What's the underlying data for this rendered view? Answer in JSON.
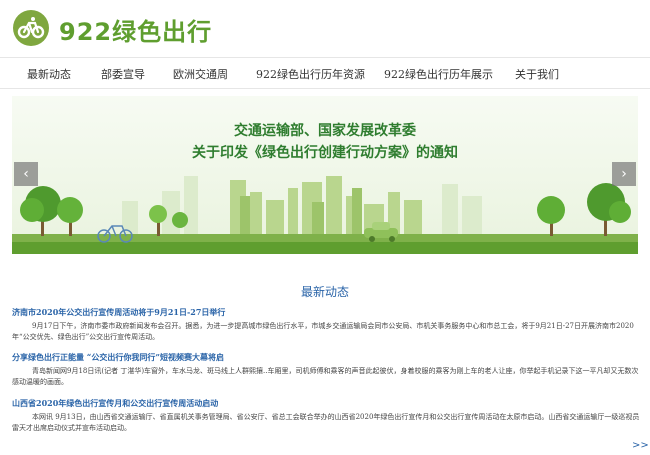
{
  "site": {
    "name": "922绿色出行",
    "brand_color": "#5f9e2f"
  },
  "nav": {
    "items": [
      {
        "label": "最新动态"
      },
      {
        "label": "部委宣导"
      },
      {
        "label": "欧洲交通周"
      },
      {
        "label": "922绿色出行历年资源"
      },
      {
        "label": "922绿色出行历年展示"
      },
      {
        "label": "关于我们"
      }
    ]
  },
  "banner": {
    "line1": "交通运输部、国家发展改革委",
    "line2": "关于印发《绿色出行创建行动方案》的通知",
    "prev_icon": "chevron-left-icon",
    "next_icon": "chevron-right-icon"
  },
  "news": {
    "section_title": "最新动态",
    "articles": [
      {
        "title": "济南市2020年公交出行宣传周活动将于9月21日-27日举行",
        "body": "9月17日下午，济南市委市政府新闻发布会召开。据悉，为进一步提高城市绿色出行水平，市城乡交通运输局会同市公安局、市机关事务服务中心和市总工会，将于9月21日-27日开展济南市2020年“公交优先、绿色出行”公交出行宣传周活动。"
      },
      {
        "title": "分享绿色出行正能量 “公交出行你我同行”短视频赛大幕将启",
        "body": "青岛新闻网9月18日讯(记者 丁湛华)车窗外，车水马龙、斑马线上人群熙攘..车厢里，司机师傅和乘客的声音此起彼伏，身着校服的乘客为刚上车的老人让座，你举起手机记录下这一平凡却又无数次感动温暖的画面。"
      },
      {
        "title": "山西省2020年绿色出行宣传月和公交出行宣传周活动启动",
        "body": "本网讯 9月13日，由山西省交通运输厅、省直属机关事务管理局、省公安厅、省总工会联合举办的山西省2020年绿色出行宣传月和公交出行宣传周活动在太原市启动。山西省交通运输厅一级巡视员雷天才出席启动仪式并宣布活动启动。"
      }
    ],
    "more_label": ">>"
  }
}
